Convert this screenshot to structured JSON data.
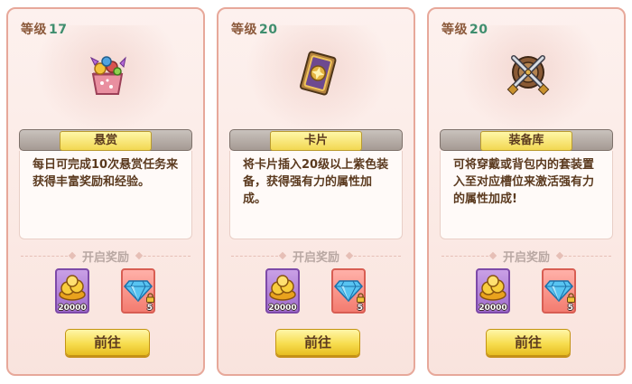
{
  "cards": [
    {
      "level_label": "等级",
      "level_value": "17",
      "icon": "gift-basket-icon",
      "title": "悬赏",
      "desc": "每日可完成10次悬赏任务来获得丰富奖励和经验。",
      "reward_header": "开启奖励",
      "rewards": [
        {
          "icon": "gold-coins-icon",
          "count": "20000",
          "locked": false
        },
        {
          "icon": "diamond-icon",
          "count": "5",
          "locked": true
        }
      ],
      "button": "前往"
    },
    {
      "level_label": "等级",
      "level_value": "20",
      "icon": "card-icon",
      "title": "卡片",
      "desc": "将卡片插入20级以上紫色装备，获得强有力的属性加成。",
      "reward_header": "开启奖励",
      "rewards": [
        {
          "icon": "gold-coins-icon",
          "count": "20000",
          "locked": false
        },
        {
          "icon": "diamond-icon",
          "count": "5",
          "locked": true
        }
      ],
      "button": "前往"
    },
    {
      "level_label": "等级",
      "level_value": "20",
      "icon": "shield-swords-icon",
      "title": "装备库",
      "desc": "可将穿戴或背包内的套装置入至对应槽位来激活强有力的属性加成!",
      "reward_header": "开启奖励",
      "rewards": [
        {
          "icon": "gold-coins-icon",
          "count": "20000",
          "locked": false
        },
        {
          "icon": "diamond-icon",
          "count": "5",
          "locked": true
        }
      ],
      "button": "前往"
    }
  ],
  "colors": {
    "card_border": "#e7a89a",
    "level_number": "#3f8e6e",
    "button_gold": "#f7dd4f",
    "reward_purple": "#9f6bcc",
    "reward_red": "#f37c70"
  }
}
